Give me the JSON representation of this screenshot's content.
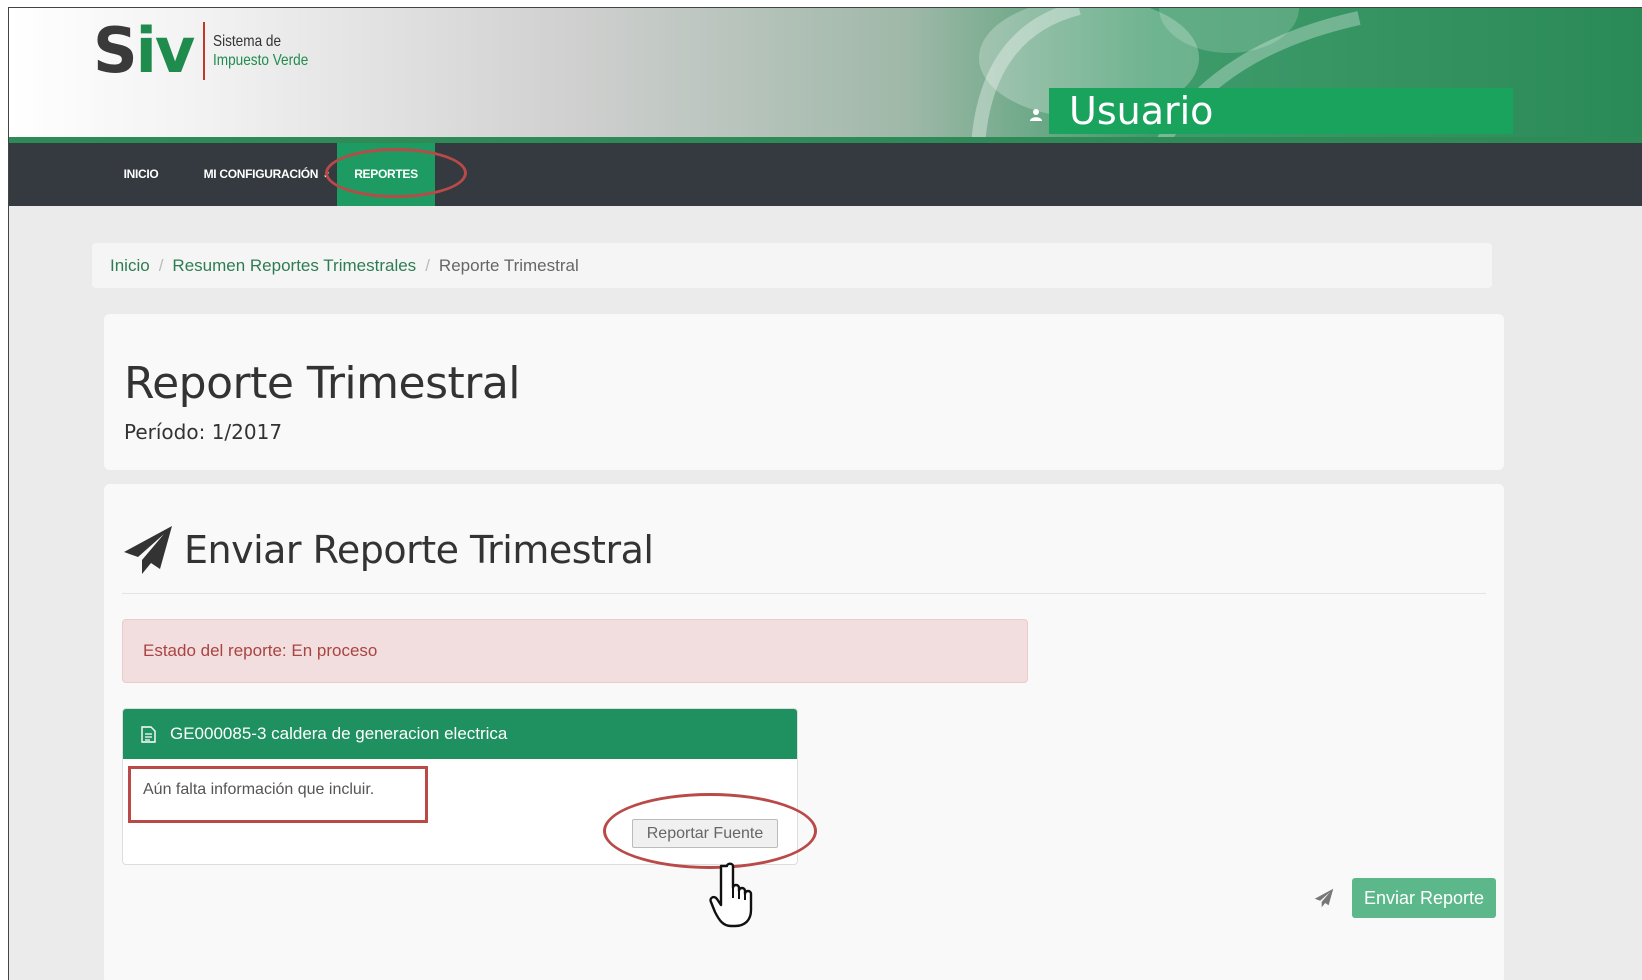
{
  "header": {
    "logo": {
      "brand_s": "S",
      "brand_iv": "iv",
      "subtitle_line1": "Sistema de",
      "subtitle_line2": "Impuesto Verde"
    },
    "user_icon": "user-icon",
    "user_label": "Usuario"
  },
  "nav": {
    "items": [
      {
        "label": "INICIO"
      },
      {
        "label": "MI CONFIGURACIÓN",
        "caret": "✓"
      },
      {
        "label": "REPORTES",
        "active": true
      }
    ]
  },
  "breadcrumb": {
    "items": [
      "Inicio",
      "Resumen Reportes Trimestrales",
      "Reporte Trimestral"
    ],
    "separator": "/"
  },
  "page": {
    "title": "Reporte Trimestral",
    "period": "Período: 1/2017"
  },
  "send_section": {
    "icon": "paper-plane-icon",
    "title": "Enviar Reporte Trimestral",
    "status_alert": "Estado del reporte: En proceso",
    "source": {
      "icon": "document-icon",
      "title": "GE000085-3 caldera de generacion electrica",
      "message": "Aún falta información que incluir.",
      "report_button": "Reportar Fuente"
    },
    "send_button": "Enviar Reporte"
  },
  "colors": {
    "brand_green": "#1f8c4e",
    "nav_dark": "#343a40",
    "active_nav": "#1e9a63",
    "alert_bg": "#f2dede",
    "alert_text": "#a94442",
    "annotation_red": "#b94a48"
  }
}
